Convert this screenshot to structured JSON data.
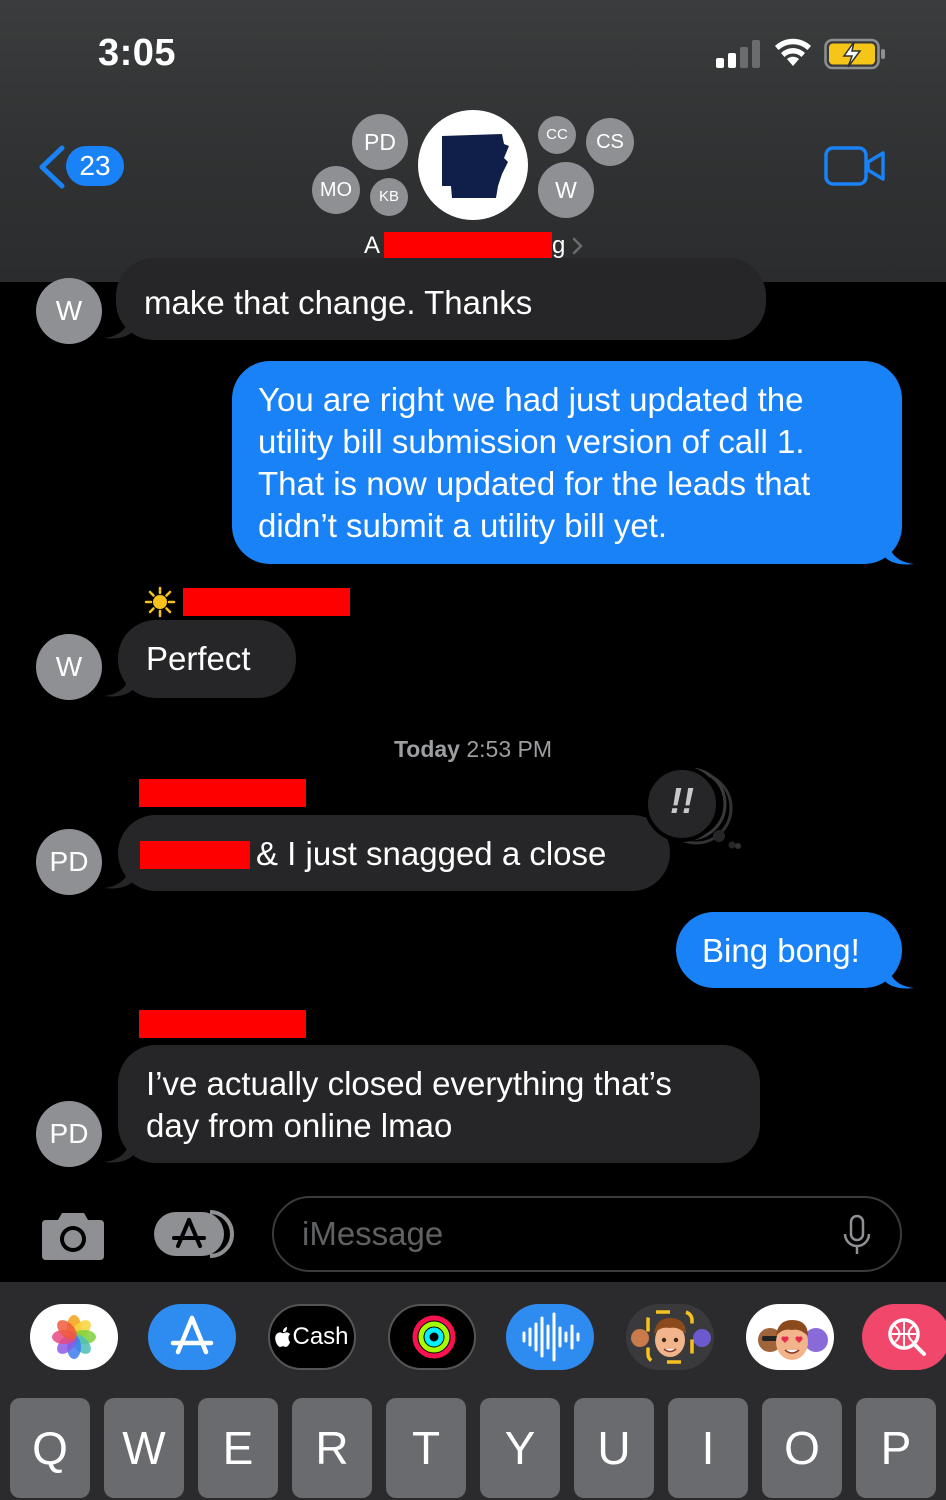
{
  "status_bar": {
    "time": "3:05"
  },
  "header": {
    "back_count": "23",
    "members": [
      "PD",
      "MO",
      "KB",
      "CC",
      "CS",
      "W"
    ],
    "name_start": "A",
    "name_end": "g"
  },
  "messages": [
    {
      "from": "W",
      "text": "make that change. Thanks"
    },
    {
      "from": "me",
      "lines": [
        "You are right we had just updated the",
        "utility bill submission version of call 1.",
        "That is now updated for the leads that",
        "didn’t submit a utility bill yet."
      ]
    },
    {
      "from": "W",
      "text": "Perfect"
    },
    {
      "from": "PD",
      "text": "& I just snagged a close"
    },
    {
      "from": "me",
      "text": "Bing bong!"
    },
    {
      "from": "PD",
      "lines": [
        "I’ve actually closed everything that’s",
        "day from online lmao"
      ]
    }
  ],
  "timestamp": {
    "day": "Today",
    "time": "2:53 PM"
  },
  "reaction": "!!",
  "compose": {
    "placeholder": "iMessage"
  },
  "tray": {
    "apps": [
      "photos-icon",
      "app-store-icon",
      "cash-icon",
      "activity-icon",
      "audio-icon",
      "memoji-icon",
      "memoji-stickers-icon",
      "search-images-icon"
    ],
    "cash_label": "Cash"
  },
  "keyboard": {
    "row1": [
      "Q",
      "W",
      "E",
      "R",
      "T",
      "Y",
      "U",
      "I",
      "O",
      "P"
    ]
  },
  "colors": {
    "imessage_blue": "#1a82f7",
    "received_bubble": "#262628",
    "redaction": "#ff0000",
    "avatar_gray": "#8e9093"
  }
}
